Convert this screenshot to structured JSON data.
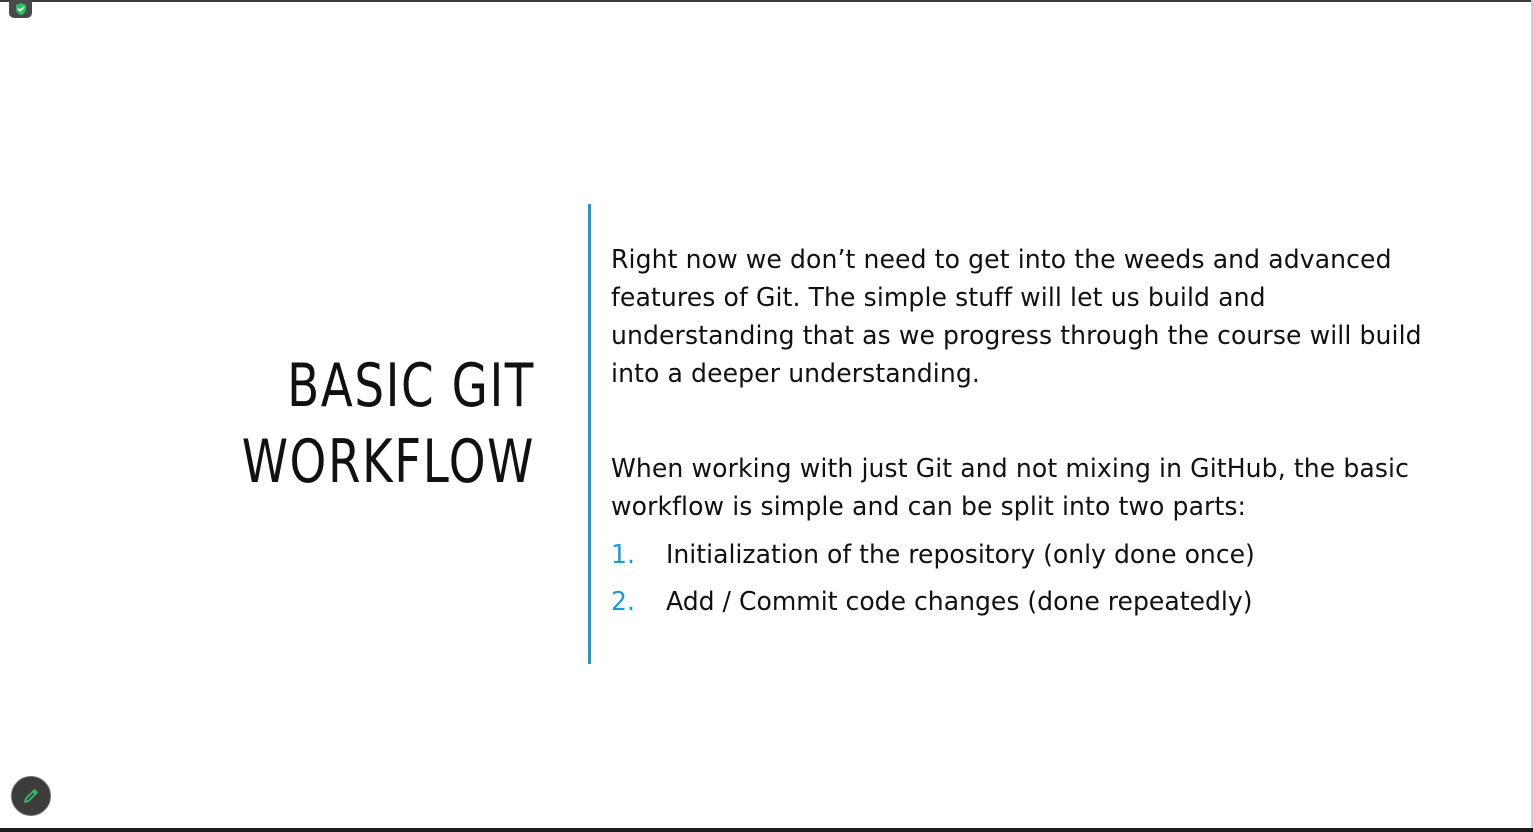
{
  "slide": {
    "title_lines": [
      "BASIC GIT",
      "WORKFLOW"
    ],
    "paragraphs": [
      [
        "Right now we don’t need to get into the weeds and advanced",
        "features of Git. The simple stuff will let us build and",
        "understanding that as we progress through the course will build",
        "into a deeper understanding."
      ],
      [
        "When working with just Git and not mixing in GitHub, the basic",
        "workflow is simple and can be split into two parts:"
      ]
    ],
    "list": [
      {
        "num": "1.",
        "text": "Initialization of the repository (only done once)"
      },
      {
        "num": "2.",
        "text": "Add / Commit code changes (done repeatedly)"
      }
    ]
  },
  "icons": {
    "badge": "shield-check-icon",
    "pen": "pen-icon"
  },
  "colors": {
    "accent": "#1a9bd7",
    "text": "#111111",
    "badge_check": "#22c55e",
    "pen_icon": "#35c46a"
  }
}
